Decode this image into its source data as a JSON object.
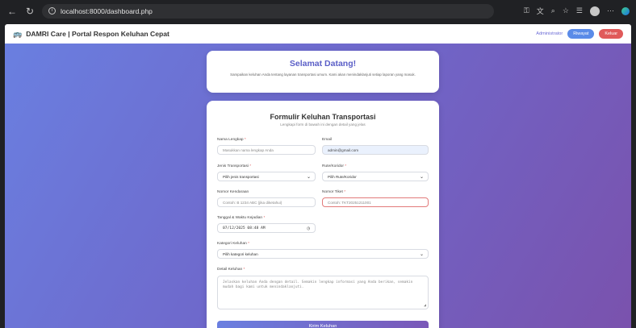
{
  "browser": {
    "url": "localhost:8000/dashboard.php"
  },
  "header": {
    "brand_icon": "bus-icon",
    "title": "DAMRI Care | Portal Respon Keluhan Cepat",
    "admin_label": "Administrator",
    "riwayat_label": "Riwayat",
    "keluar_label": "Keluar"
  },
  "welcome": {
    "title": "Selamat Datang!",
    "text": "Sampaikan keluhan Anda tentang layanan transportasi umum. Kami akan menindaklanjuti setiap laporan yang masuk."
  },
  "form": {
    "title": "Formulir Keluhan Transportasi",
    "subtitle": "Lengkapi form di bawah ini dengan detail yang jelas",
    "nama": {
      "label": "Nama Lengkap",
      "placeholder": "Masukkan nama lengkap Anda"
    },
    "email": {
      "label": "Email",
      "value": "admin@gmail.com"
    },
    "jenis": {
      "label": "Jenis Transportasi",
      "value": "Pilih jenis transportasi"
    },
    "rute": {
      "label": "Rute/Koridor",
      "value": "Pilih Rute/Koridor"
    },
    "kendaraan": {
      "label": "Nomor Kendaraan",
      "placeholder": "Contoh: B 1234 ABC (jika diketahui)"
    },
    "tiket": {
      "label": "Nomor Tiket",
      "placeholder": "Contoh: TKT20251211001"
    },
    "tanggal": {
      "label": "Tanggal & Waktu Kejadian",
      "value": "07/12/2025 08:48 AM"
    },
    "kategori": {
      "label": "Kategori Keluhan",
      "value": "Pilih kategori keluhan"
    },
    "detail": {
      "label": "Detail Keluhan",
      "placeholder": "Jelaskan keluhan Anda dengan detail. Semakin lengkap informasi yang Anda berikan, semakin mudah bagi kami untuk menindaklanjuti."
    },
    "submit_label": "Kirim Keluhan",
    "required_mark": "*"
  }
}
